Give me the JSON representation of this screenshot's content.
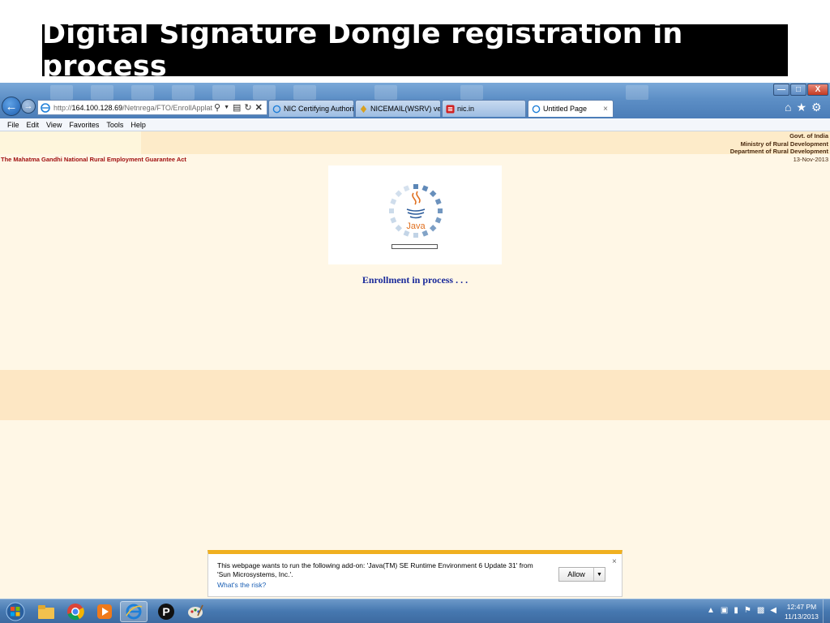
{
  "slide": {
    "title": "Digital Signature Dongle registration in process"
  },
  "browser": {
    "address": {
      "scheme": "http://",
      "host": "164.100.128.69",
      "path": "/Netnrega/FTO/EnrollApplate.aspx"
    },
    "tabs": [
      {
        "label": "NIC Certifying Authority"
      },
      {
        "label": "NICEMAIL(WSRV) ver S..."
      },
      {
        "label": "nic.in"
      },
      {
        "label": "Untitled Page",
        "close": "×"
      }
    ],
    "window_buttons": {
      "minimize": "—",
      "maximize": "□",
      "close": "X"
    },
    "menu": [
      "File",
      "Edit",
      "View",
      "Favorites",
      "Tools",
      "Help"
    ]
  },
  "page": {
    "header_lines": [
      "Govt. of India",
      "Ministry of Rural Development",
      "Department of Rural Development"
    ],
    "scheme_name": "The Mahatma Gandhi National Rural Employment Guarantee Act",
    "date": "13-Nov-2013",
    "applet": {
      "logo_text": "Java",
      "progress": 0
    },
    "status_text": "Enrollment in process . . ."
  },
  "notification": {
    "message": "This webpage wants to run the following add-on: 'Java(TM) SE Runtime Environment 6 Update 31' from 'Sun Microsystems, Inc.'.",
    "link": "What's the risk?",
    "allow_label": "Allow",
    "close": "×"
  },
  "taskbar": {
    "items": [
      "start-orb",
      "windows-explorer",
      "chrome",
      "media-player",
      "internet-explorer",
      "password-app",
      "paint"
    ],
    "clock_time": "12:47 PM",
    "clock_date": "11/13/2013"
  },
  "colors": {
    "title_bg": "#000000",
    "page_bg": "#fff7e6",
    "status_text": "#1a2a9a",
    "scheme_text": "#a01010",
    "notify_accent": "#f0b020"
  }
}
